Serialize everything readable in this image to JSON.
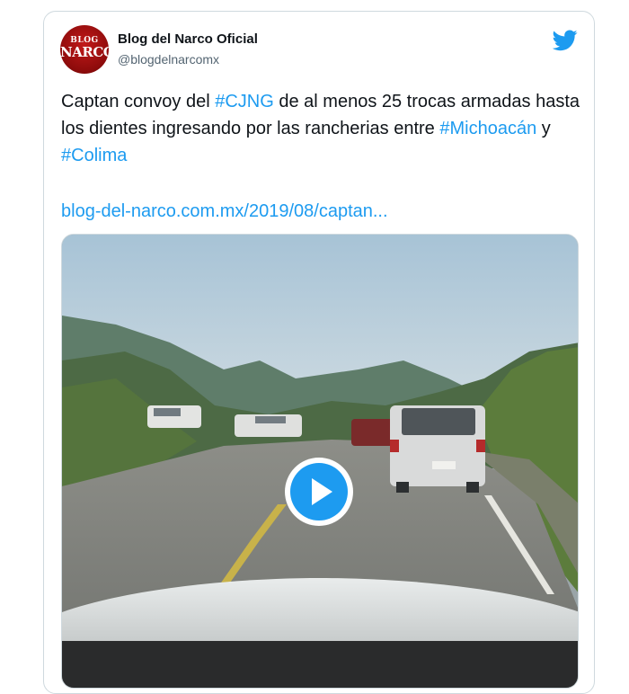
{
  "author": {
    "name": "Blog del Narco Oficial",
    "handle": "@blogdelnarcomx",
    "avatar_text_line1": "BLOG",
    "avatar_text_line2": "NARCO"
  },
  "tweet": {
    "text_part1": "Captan convoy del ",
    "hashtag1": "#CJNG",
    "text_part2": " de al menos 25 trocas armadas hasta los dientes ingresando por las rancherias entre ",
    "hashtag2": "#Michoacán",
    "text_part3": " y ",
    "hashtag3": "#Colima",
    "link": "blog-del-narco.com.mx/2019/08/captan..."
  },
  "icons": {
    "brand": "twitter-bird-icon",
    "play": "play-icon"
  },
  "colors": {
    "accent": "#1d9bf0",
    "text": "#0f1419",
    "secondary": "#536471",
    "border": "#cfd9de"
  }
}
